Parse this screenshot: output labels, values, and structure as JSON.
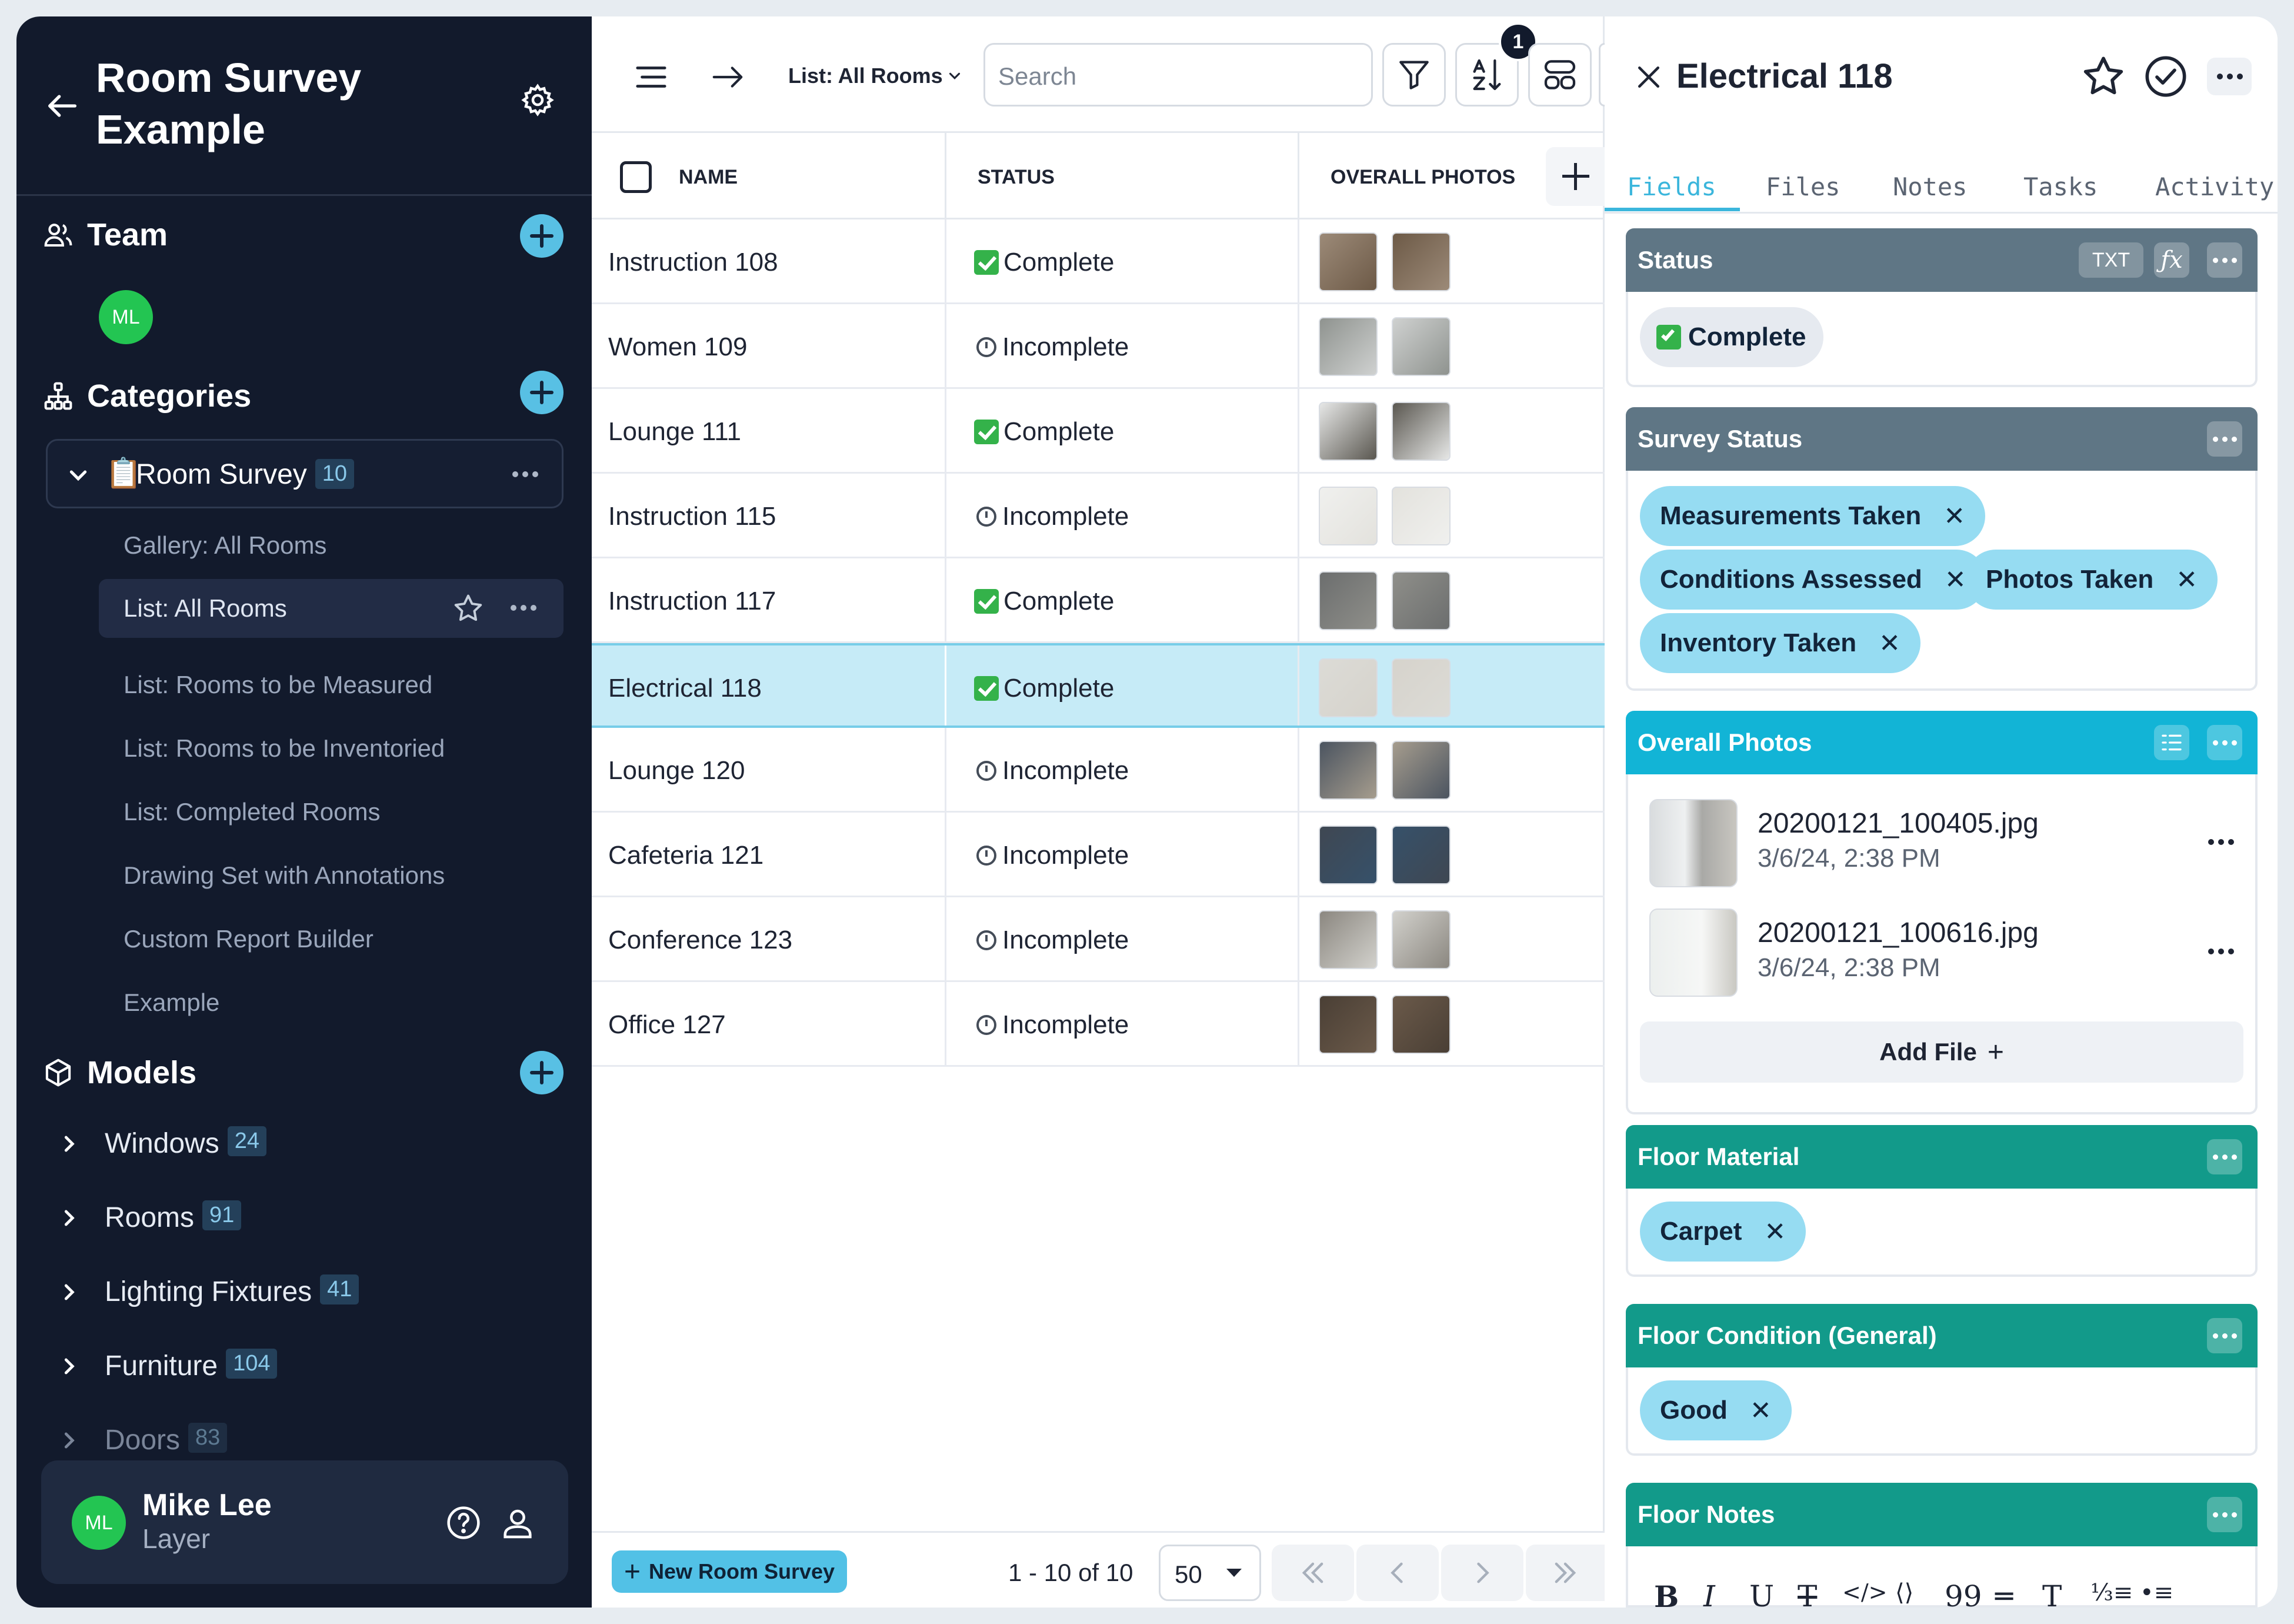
{
  "sidebar": {
    "title": "Room Survey Example",
    "team_label": "Team",
    "team_avatar": "ML",
    "categories_label": "Categories",
    "category": {
      "icon": "📋",
      "label": "Room Survey",
      "count": "10"
    },
    "sub_items": [
      "Gallery: All Rooms",
      "List: All Rooms",
      "List: Rooms to be Measured",
      "List: Rooms to be Inventoried",
      "List: Completed Rooms",
      "Drawing Set with Annotations",
      "Custom Report Builder",
      "Example"
    ],
    "models_label": "Models",
    "models": [
      {
        "label": "Windows",
        "count": "24"
      },
      {
        "label": "Rooms",
        "count": "91"
      },
      {
        "label": "Lighting Fixtures",
        "count": "41"
      },
      {
        "label": "Furniture",
        "count": "104"
      },
      {
        "label": "Doors",
        "count": "83"
      }
    ],
    "user": {
      "avatar": "ML",
      "name": "Mike Lee",
      "org": "Layer"
    }
  },
  "toolbar": {
    "view_name": "List: All Rooms",
    "search_placeholder": "Search",
    "filter_count": "1"
  },
  "table": {
    "columns": [
      "NAME",
      "STATUS",
      "OVERALL PHOTOS"
    ],
    "rows": [
      {
        "name": "Instruction 108",
        "status": "Complete"
      },
      {
        "name": "Women 109",
        "status": "Incomplete"
      },
      {
        "name": "Lounge 111",
        "status": "Complete"
      },
      {
        "name": "Instruction 115",
        "status": "Incomplete"
      },
      {
        "name": "Instruction 117",
        "status": "Complete"
      },
      {
        "name": "Electrical 118",
        "status": "Complete"
      },
      {
        "name": "Lounge 120",
        "status": "Incomplete"
      },
      {
        "name": "Cafeteria 121",
        "status": "Incomplete"
      },
      {
        "name": "Conference 123",
        "status": "Incomplete"
      },
      {
        "name": "Office 127",
        "status": "Incomplete"
      }
    ],
    "selected_index": 5
  },
  "footer": {
    "new_button": "New Room Survey",
    "page_info": "1 - 10 of 10",
    "page_size": "50"
  },
  "panel": {
    "title": "Electrical 118",
    "tabs": [
      "Fields",
      "Files",
      "Notes",
      "Tasks",
      "Activity"
    ],
    "active_tab": "Fields",
    "status": {
      "label": "Status",
      "type_badge": "TXT",
      "value": "Complete"
    },
    "survey_status": {
      "label": "Survey Status",
      "values": [
        "Measurements Taken",
        "Conditions Assessed",
        "Photos Taken",
        "Inventory Taken"
      ]
    },
    "overall_photos": {
      "label": "Overall Photos",
      "files": [
        {
          "name": "20200121_100405.jpg",
          "date": "3/6/24, 2:38 PM"
        },
        {
          "name": "20200121_100616.jpg",
          "date": "3/6/24, 2:38 PM"
        }
      ],
      "add_file": "Add File"
    },
    "floor_material": {
      "label": "Floor Material",
      "value": "Carpet"
    },
    "floor_condition": {
      "label": "Floor Condition (General)",
      "value": "Good"
    },
    "floor_notes": {
      "label": "Floor Notes"
    }
  },
  "colors": {
    "sidebar_bg": "#121a2c",
    "accent": "#52c1e6",
    "field_header_grey": "#5f7685",
    "field_header_cyan": "#12b4d6",
    "field_header_teal": "#129a8a",
    "selected_row": "#c6ebf7",
    "avatar_green": "#23c552"
  }
}
